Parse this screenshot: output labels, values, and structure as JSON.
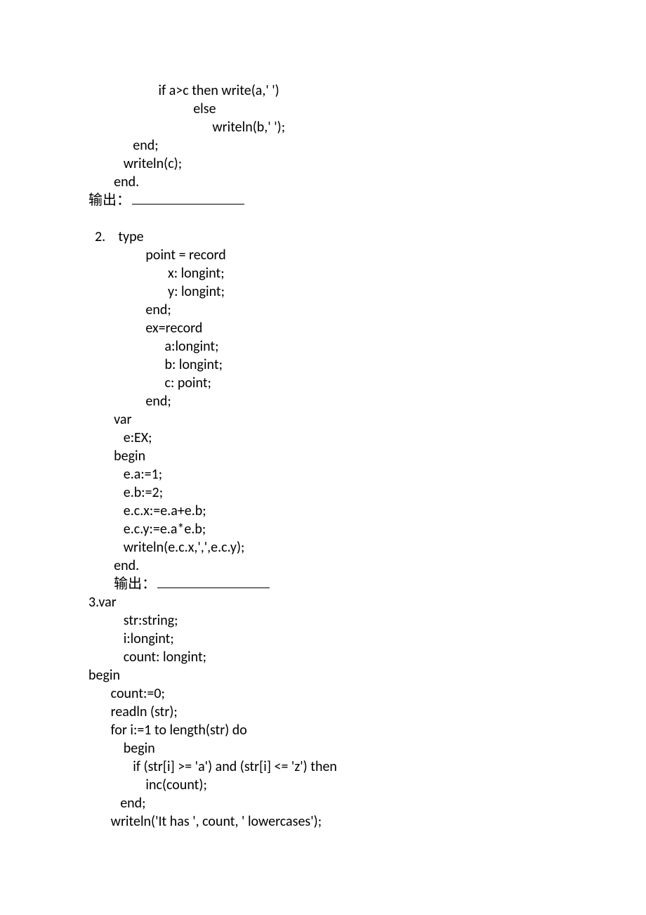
{
  "lines": {
    "l01": "                      if a>c then write(a,' ')",
    "l02": "                                 else",
    "l03": "                                       writeln(b,' ');",
    "l04": "              end;",
    "l05": "           writeln(c);",
    "l06": "        end.",
    "l07a": "输出：",
    "l08": "  2.    type",
    "l09": "                  point = record",
    "l10": "                         x: longint;",
    "l11": "                         y: longint;",
    "l12": "                  end;",
    "l13": "                  ex=record",
    "l14": "                        a:longint;",
    "l15": "                        b: longint;",
    "l16": "                        c: point;",
    "l17": "                  end;",
    "l18": "        var",
    "l19": "           e:EX;",
    "l20": "        begin",
    "l21": "           e.a:=1;",
    "l22": "           e.b:=2;",
    "l23": "           e.c.x:=e.a+e.b;",
    "l24": "           e.c.y:=e.a*e.b;",
    "l25": "           writeln(e.c.x,',',e.c.y);",
    "l26": "        end.",
    "l27pre": "        ",
    "l27a": "输出：",
    "l28": "3.var",
    "l29": "           str:string;",
    "l30": "           i:longint;",
    "l31": "           count: longint;",
    "l32": "begin",
    "l33": "       count:=0;",
    "l34": "       readln (str);",
    "l35": "       for i:=1 to length(str) do",
    "l36": "           begin",
    "l37": "              if (str[i] >= 'a') and (str[i] <= 'z') then",
    "l38": "                  inc(count);",
    "l39": "          end;",
    "l40": "       writeln('It has ', count, ' lowercases');"
  }
}
